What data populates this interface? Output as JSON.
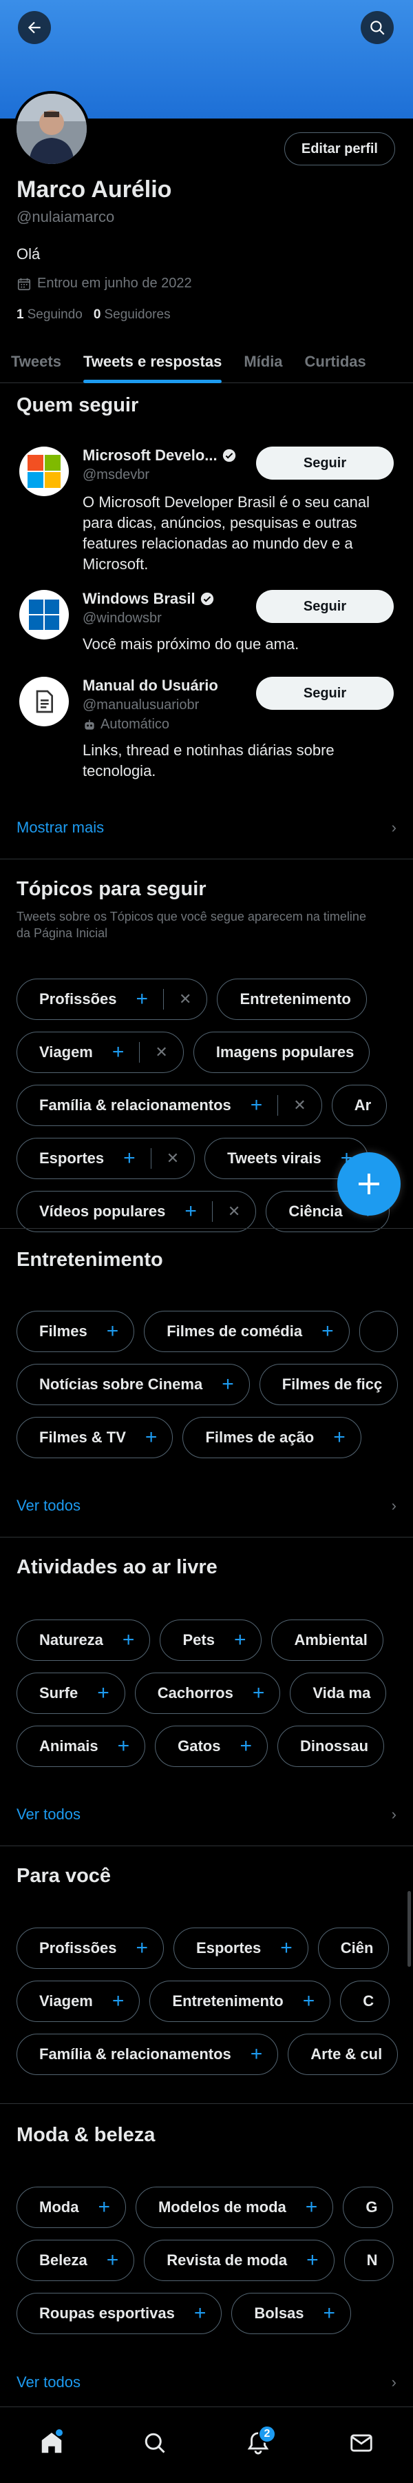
{
  "profile": {
    "name": "Marco Aurélio",
    "handle": "@nulaiamarco",
    "bio": "Olá",
    "joined": "Entrou em junho de 2022",
    "following_count": "1",
    "following_label": "Seguindo",
    "followers_count": "0",
    "followers_label": "Seguidores",
    "edit_label": "Editar perfil"
  },
  "tabs": [
    {
      "label": "Tweets"
    },
    {
      "label": "Tweets e respostas"
    },
    {
      "label": "Mídia"
    },
    {
      "label": "Curtidas"
    }
  ],
  "who_to_follow": {
    "title": "Quem seguir",
    "accounts": [
      {
        "name": "Microsoft Develo...",
        "handle": "@msdevbr",
        "bio": "O Microsoft Developer Brasil é o seu canal para dicas, anúncios, pesquisas e outras features relacionadas ao mundo dev e a Microsoft.",
        "button": "Seguir"
      },
      {
        "name": "Windows Brasil",
        "handle": "@windowsbr",
        "bio": "Você mais próximo do que ama.",
        "button": "Seguir"
      },
      {
        "name": "Manual do Usuário",
        "handle": "@manualusuariobr",
        "automated": "Automático",
        "bio": "Links, thread e notinhas diárias sobre tecnologia.",
        "button": "Seguir"
      }
    ],
    "show_more": "Mostrar mais"
  },
  "topics": {
    "title": "Tópicos para seguir",
    "subtitle": "Tweets sobre os Tópicos que você segue aparecem na timeline da Página Inicial",
    "rows": [
      [
        "Profissões",
        "Entretenimento"
      ],
      [
        "Viagem",
        "Imagens populares"
      ],
      [
        "Família & relacionamentos",
        "Ar"
      ],
      [
        "Esportes",
        "Tweets virais"
      ],
      [
        "Vídeos populares",
        "Ciência"
      ]
    ]
  },
  "entertainment": {
    "title": "Entretenimento",
    "rows": [
      [
        "Filmes",
        "Filmes de comédia"
      ],
      [
        "Notícias sobre Cinema",
        "Filmes de ficç"
      ],
      [
        "Filmes & TV",
        "Filmes de ação"
      ]
    ],
    "see_all": "Ver todos"
  },
  "outdoor": {
    "title": "Atividades ao ar livre",
    "rows": [
      [
        "Natureza",
        "Pets",
        "Ambiental"
      ],
      [
        "Surfe",
        "Cachorros",
        "Vida ma"
      ],
      [
        "Animais",
        "Gatos",
        "Dinossau"
      ]
    ],
    "see_all": "Ver todos"
  },
  "for_you": {
    "title": "Para você",
    "rows": [
      [
        "Profissões",
        "Esportes",
        "Ciên"
      ],
      [
        "Viagem",
        "Entretenimento",
        "C"
      ],
      [
        "Família & relacionamentos",
        "Arte & cul"
      ]
    ]
  },
  "fashion": {
    "title": "Moda & beleza",
    "rows": [
      [
        "Moda",
        "Modelos de moda",
        "G"
      ],
      [
        "Beleza",
        "Revista de moda",
        "N"
      ],
      [
        "Roupas esportivas",
        "Bolsas"
      ]
    ],
    "see_all": "Ver todos"
  },
  "nav": {
    "notifications_badge": "2"
  },
  "colors": {
    "accent": "#1d9bf0",
    "background": "#000000",
    "banner": "#1d6fd6"
  }
}
